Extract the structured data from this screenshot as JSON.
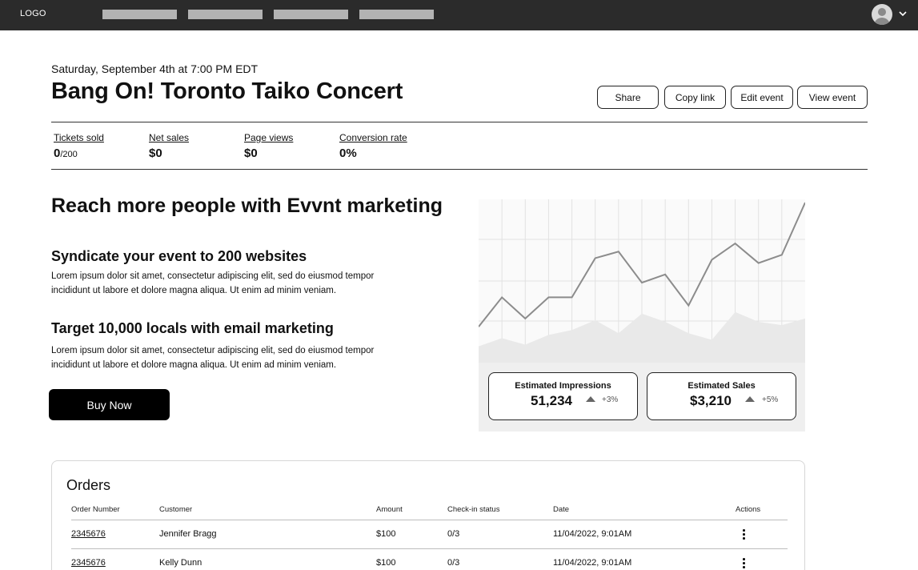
{
  "nav": {
    "logo": "LOGO",
    "links": [
      "",
      "",
      "",
      ""
    ]
  },
  "event": {
    "date": "Saturday, September 4th at 7:00 PM EDT",
    "title": "Bang On! Toronto Taiko Concert",
    "actions": {
      "share": "Share",
      "copy_link": "Copy link",
      "edit_event": "Edit event",
      "view_event": "View event"
    }
  },
  "stats": [
    {
      "label": "Tickets sold",
      "value": "0",
      "suffix": "/200"
    },
    {
      "label": "Net sales",
      "value": "$0"
    },
    {
      "label": "Page views",
      "value": "$0"
    },
    {
      "label": "Conversion rate",
      "value": "0%"
    }
  ],
  "marketing": {
    "title": "Reach more people with Evvnt marketing",
    "features": [
      {
        "heading": "Syndicate your event to 200 websites",
        "body": "Lorem ipsum dolor sit amet, consectetur adipiscing elit, sed do eiusmod tempor incididunt ut labore et dolore magna aliqua. Ut enim ad minim veniam."
      },
      {
        "heading": "Target 10,000 locals with email marketing",
        "body": "Lorem ipsum dolor sit amet, consectetur adipiscing elit, sed do eiusmod tempor incididunt ut labore et dolore magna aliqua. Ut enim ad minim veniam."
      }
    ],
    "buy_label": "Buy Now"
  },
  "estimates": {
    "impressions": {
      "label": "Estimated Impressions",
      "value": "51,234",
      "delta": "+3%"
    },
    "sales": {
      "label": "Estimated Sales",
      "value": "$3,210",
      "delta": "+5%"
    }
  },
  "chart_data": {
    "type": "line",
    "title": "",
    "xlabel": "",
    "ylabel": "",
    "x": [
      0,
      1,
      2,
      3,
      4,
      5,
      6,
      7,
      8,
      9,
      10,
      11,
      12,
      13,
      14
    ],
    "ylim": [
      0,
      100
    ],
    "grid": true,
    "series": [
      {
        "values": [
          22,
          40,
          27,
          40,
          40,
          64,
          68,
          49,
          54,
          35,
          63,
          73,
          61,
          66,
          98
        ]
      },
      {
        "values": [
          10,
          15,
          11,
          17,
          20,
          26,
          18,
          30,
          25,
          18,
          14,
          31,
          25,
          23,
          27
        ]
      }
    ]
  },
  "orders": {
    "title": "Orders",
    "columns": [
      "Order Number",
      "Customer",
      "Amount",
      "Check-in status",
      "Date",
      "Actions"
    ],
    "rows": [
      {
        "order": "2345676",
        "customer": "Jennifer Bragg",
        "amount": "$100",
        "checkin": "0/3",
        "date": "11/04/2022, 9:01AM"
      },
      {
        "order": "2345676",
        "customer": "Kelly Dunn",
        "amount": "$100",
        "checkin": "0/3",
        "date": "11/04/2022, 9:01AM"
      }
    ]
  }
}
